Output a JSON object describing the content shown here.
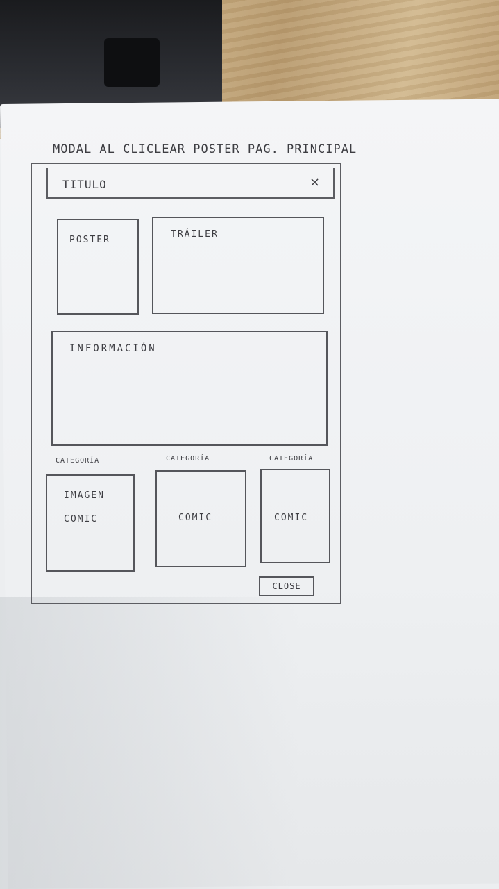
{
  "page_heading": "MODAL AL CLICLEAR POSTER PAG. PRINCIPAL",
  "modal": {
    "title": "TITULO",
    "close_icon": "×",
    "poster_label": "POSTER",
    "trailer_label": "TRÁILER",
    "info_label": "INFORMACIÓN",
    "comics": [
      {
        "category": "CATEGORÍA",
        "line1": "IMAGEN",
        "line2": "COMIC"
      },
      {
        "category": "CATEGORÍA",
        "line1": "COMIC"
      },
      {
        "category": "CATEGORÍA",
        "line1": "COMIC"
      }
    ],
    "close_button": "CLOSE"
  }
}
